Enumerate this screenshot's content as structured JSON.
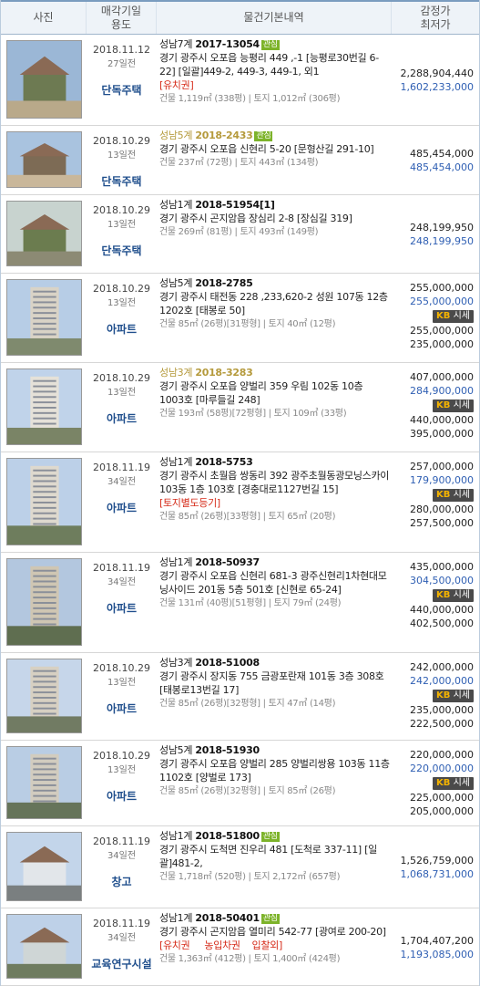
{
  "header": {
    "photo": "사진",
    "sale_date_line1": "매각기일",
    "sale_date_line2": "용도",
    "property": "물건기본내역",
    "appraisal_line1": "감정가",
    "appraisal_line2": "최저가"
  },
  "market_button": {
    "prefix": "KB",
    "label": "시세"
  },
  "rows": [
    {
      "date": "2018.11.12",
      "ago": "27일전",
      "type": "단독주택",
      "court": "성남7계",
      "case_no": "2017-13054",
      "tag": "관심",
      "address": "경기 광주시 오포읍 능평리 449 ,-1 [능평로30번길 6-22] [일괄]449-2, 449-3, 449-1, 외1",
      "special": "[유치권]",
      "size": "건물 1,119㎡ (338평) | 토지 1,012㎡ (306평)",
      "prices": [
        "2,288,904,440",
        "1,602,233,000"
      ]
    },
    {
      "date": "2018.10.29",
      "ago": "13일전",
      "type": "단독주택",
      "court": "성남5계",
      "case_no": "2018-2433",
      "tag": "관심",
      "address": "경기 광주시 오포읍 신현리 5-20 [문형산길 291-10]",
      "special": "",
      "size": "건물 237㎡ (72평) | 토지 443㎡ (134평)",
      "prices": [
        "485,454,000",
        "485,454,000"
      ]
    },
    {
      "date": "2018.10.29",
      "ago": "13일전",
      "type": "단독주택",
      "court": "성남1계",
      "case_no": "2018-51954[1]",
      "tag": "",
      "address": "경기 광주시 곤지암읍 장심리 2-8 [장심길 319]",
      "special": "",
      "size": "건물 269㎡ (81평) | 토지 493㎡ (149평)",
      "prices": [
        "248,199,950",
        "248,199,950"
      ]
    },
    {
      "date": "2018.10.29",
      "ago": "13일전",
      "type": "아파트",
      "court": "성남5계",
      "case_no": "2018-2785",
      "tag": "",
      "address": "경기 광주시 태전동 228 ,233,620-2 성원 107동 12층 1202호 [태봉로 50]",
      "special": "",
      "size": "건물 85㎡ (26평)[31평형] | 토지 40㎡ (12평)",
      "prices": [
        "255,000,000",
        "255,000,000"
      ],
      "market": [
        "255,000,000",
        "235,000,000"
      ]
    },
    {
      "date": "2018.10.29",
      "ago": "13일전",
      "type": "아파트",
      "court": "성남3계",
      "case_no": "2018-3283",
      "tag": "",
      "address": "경기 광주시 오포읍 양벌리 359 우림 102동 10층 1003호 [마루들길 248]",
      "special": "",
      "size": "건물 193㎡ (58평)[72평형] | 토지 109㎡ (33평)",
      "prices": [
        "407,000,000",
        "284,900,000"
      ],
      "market": [
        "440,000,000",
        "395,000,000"
      ]
    },
    {
      "date": "2018.11.19",
      "ago": "34일전",
      "type": "아파트",
      "court": "성남1계",
      "case_no": "2018-5753",
      "tag": "",
      "address": "경기 광주시 초월읍 쌍동리 392 광주초월동광모닝스카이 103동 1층 103호 [경충대로1127번길 15]",
      "special": "[토지별도등기]",
      "size": "건물 85㎡ (26평)[33평형] | 토지 65㎡ (20평)",
      "prices": [
        "257,000,000",
        "179,900,000"
      ],
      "market": [
        "280,000,000",
        "257,500,000"
      ]
    },
    {
      "date": "2018.11.19",
      "ago": "34일전",
      "type": "아파트",
      "court": "성남1계",
      "case_no": "2018-50937",
      "tag": "",
      "address": "경기 광주시 오포읍 신현리 681-3 광주신현리1차현대모닝사이드 201동 5층 501호 [신현로 65-24]",
      "special": "",
      "size": "건물 131㎡ (40평)[51평형] | 토지 79㎡ (24평)",
      "prices": [
        "435,000,000",
        "304,500,000"
      ],
      "market": [
        "440,000,000",
        "402,500,000"
      ]
    },
    {
      "date": "2018.10.29",
      "ago": "13일전",
      "type": "아파트",
      "court": "성남3계",
      "case_no": "2018-51008",
      "tag": "",
      "address": "경기 광주시 장지동 755 금광포란재 101동 3층 308호 [태봉로13번길 17]",
      "special": "",
      "size": "건물 85㎡ (26평)[32평형] | 토지 47㎡ (14평)",
      "prices": [
        "242,000,000",
        "242,000,000"
      ],
      "market": [
        "235,000,000",
        "222,500,000"
      ]
    },
    {
      "date": "2018.10.29",
      "ago": "13일전",
      "type": "아파트",
      "court": "성남5계",
      "case_no": "2018-51930",
      "tag": "",
      "address": "경기 광주시 오포읍 양벌리 285 양벌리쌍용 103동 11층 1102호 [양벌로 173]",
      "special": "",
      "size": "건물 85㎡ (26평)[32평형] | 토지 85㎡ (26평)",
      "prices": [
        "220,000,000",
        "220,000,000"
      ],
      "market": [
        "225,000,000",
        "205,000,000"
      ]
    },
    {
      "date": "2018.11.19",
      "ago": "34일전",
      "type": "창고",
      "court": "성남1계",
      "case_no": "2018-51800",
      "tag": "관심",
      "address": "경기 광주시 도척면 진우리 481 [도척로 337-11] [일괄]481-2,",
      "special": "",
      "size": "건물 1,718㎡ (520평) | 토지 2,172㎡ (657평)",
      "prices": [
        "1,526,759,000",
        "1,068,731,000"
      ]
    },
    {
      "date": "2018.11.19",
      "ago": "34일전",
      "type": "교육연구시설",
      "court": "성남1계",
      "case_no": "2018-50401",
      "tag": "관심",
      "address": "경기 광주시 곤지암읍 열미리 542-77 [광여로 200-20]",
      "special": "[유치권     농입차권    입찰외]",
      "size": "건물 1,363㎡ (412평) | 토지 1,400㎡ (424평)",
      "prices": [
        "1,704,407,200",
        "1,193,085,000"
      ]
    }
  ]
}
